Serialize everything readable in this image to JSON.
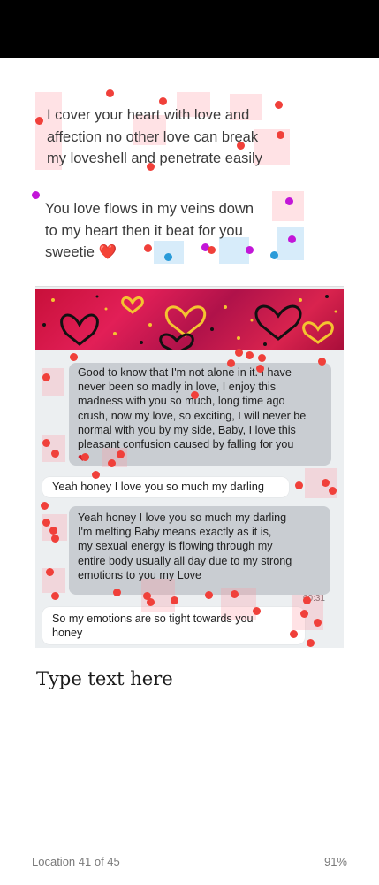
{
  "messages": [
    {
      "lines": [
        "I cover your heart with love and",
        "affection no other love can break",
        "my loveshell and penetrate easily"
      ]
    },
    {
      "lines": [
        "You love flows in my veins down",
        "to my heart then it beat for you",
        "sweetie"
      ],
      "emoji": "❤️"
    }
  ],
  "chat_screenshot": {
    "bubble_1": {
      "lines": [
        "Good to know that I'm not alone in it. I have",
        "never been so madly in love, I enjoy this",
        "madness with you so much, long time ago",
        "crush, now my love, so exciting, I will never be",
        "normal with you by my side, Baby, I love this",
        "pleasant confusion caused by falling for you"
      ],
      "emoji": "❤"
    },
    "bubble_2": {
      "lines": [
        "Yeah honey I love you so much my darling"
      ]
    },
    "bubble_3": {
      "lines": [
        "Yeah honey I love you so much my darling",
        "I'm melting Baby means exactly as it is,",
        "my sexual energy is flowing through my",
        "entire body usually all day due to my strong",
        "emotions to you my Love"
      ],
      "time": "00:31"
    },
    "bubble_4": {
      "lines": [
        "So my emotions are so tight towards you",
        "honey"
      ]
    }
  },
  "placeholder_text": "Type text here",
  "footer": {
    "location": "Location 41 of 45",
    "progress": "91%"
  }
}
